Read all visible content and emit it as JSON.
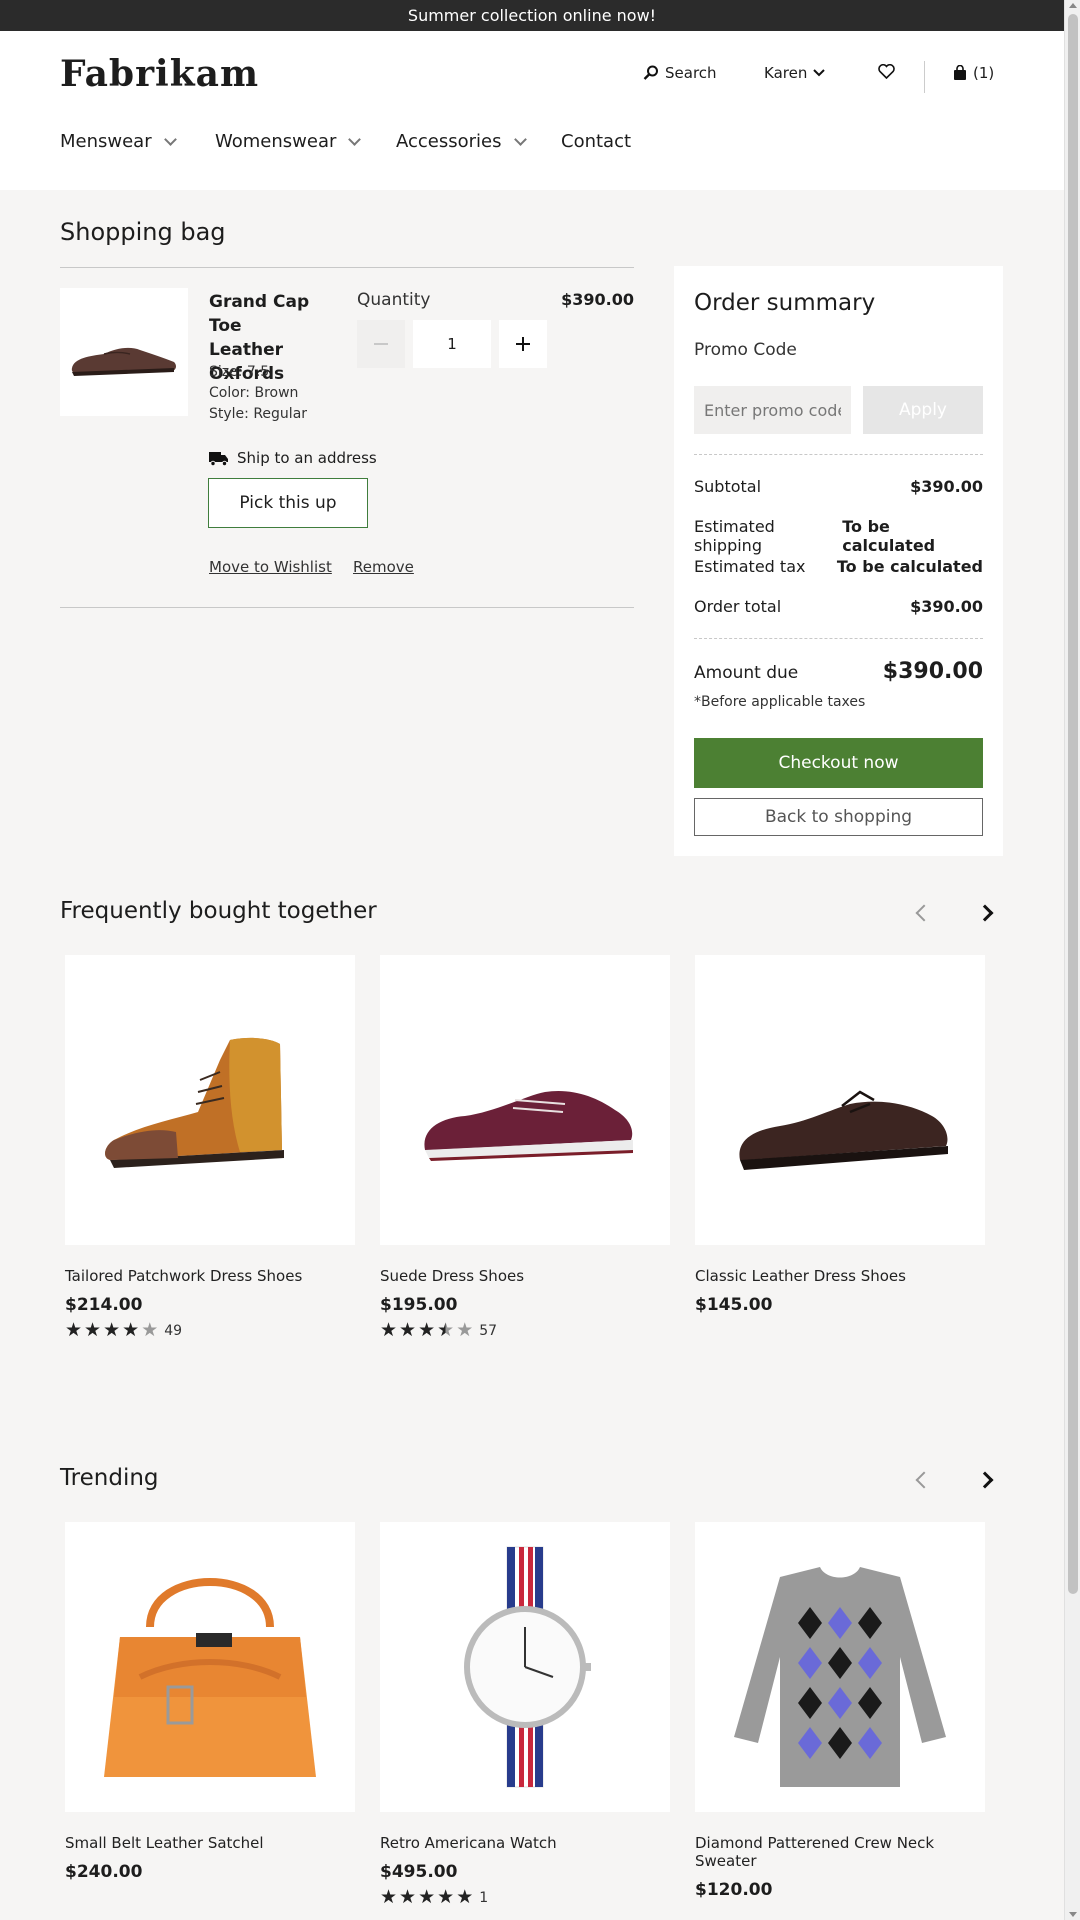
{
  "banner": "Summer collection online now!",
  "header": {
    "logo": "Fabrikam",
    "search": "Search",
    "user": "Karen",
    "cart": "(1)",
    "nav": [
      "Menswear",
      "Womenswear",
      "Accessories",
      "Contact"
    ]
  },
  "bag": {
    "title": "Shopping bag",
    "item": {
      "name": "Grand Cap Toe Leather Oxfords",
      "size": "Size:  7.5",
      "color": "Color:  Brown",
      "style": "Style:  Regular",
      "quantity_label": "Quantity",
      "quantity": "1",
      "price": "$390.00",
      "ship": "Ship to an address",
      "pickup": "Pick this up",
      "wishlist": "Move to Wishlist",
      "remove": "Remove"
    }
  },
  "summary": {
    "title": "Order summary",
    "promo_label": "Promo Code",
    "promo_placeholder": "Enter promo code",
    "apply": "Apply",
    "subtotal_label": "Subtotal",
    "subtotal": "$390.00",
    "shipping_label": "Estimated shipping",
    "shipping": "To be calculated",
    "tax_label": "Estimated tax",
    "tax": "To be calculated",
    "total_label": "Order total",
    "total": "$390.00",
    "amount_label": "Amount due",
    "amount": "$390.00",
    "note": "*Before applicable taxes",
    "checkout": "Checkout now",
    "back": "Back to shopping"
  },
  "fbt": {
    "title": "Frequently bought together",
    "items": [
      {
        "name": "Tailored Patchwork Dress Shoes",
        "price": "$214.00",
        "rating": 4,
        "count": "49"
      },
      {
        "name": "Suede Dress Shoes",
        "price": "$195.00",
        "rating": 3.5,
        "count": "57"
      },
      {
        "name": "Classic Leather Dress Shoes",
        "price": "$145.00"
      }
    ]
  },
  "trending": {
    "title": "Trending",
    "items": [
      {
        "name": "Small Belt Leather Satchel",
        "price": "$240.00"
      },
      {
        "name": "Retro Americana Watch",
        "price": "$495.00",
        "rating": 5,
        "count": "1"
      },
      {
        "name": "Diamond Patterened Crew Neck Sweater",
        "price": "$120.00"
      }
    ]
  },
  "colors": {
    "accent_green": "#4c8033",
    "banner_bg": "#2b2b2b",
    "page_bg": "#f6f5f4"
  }
}
